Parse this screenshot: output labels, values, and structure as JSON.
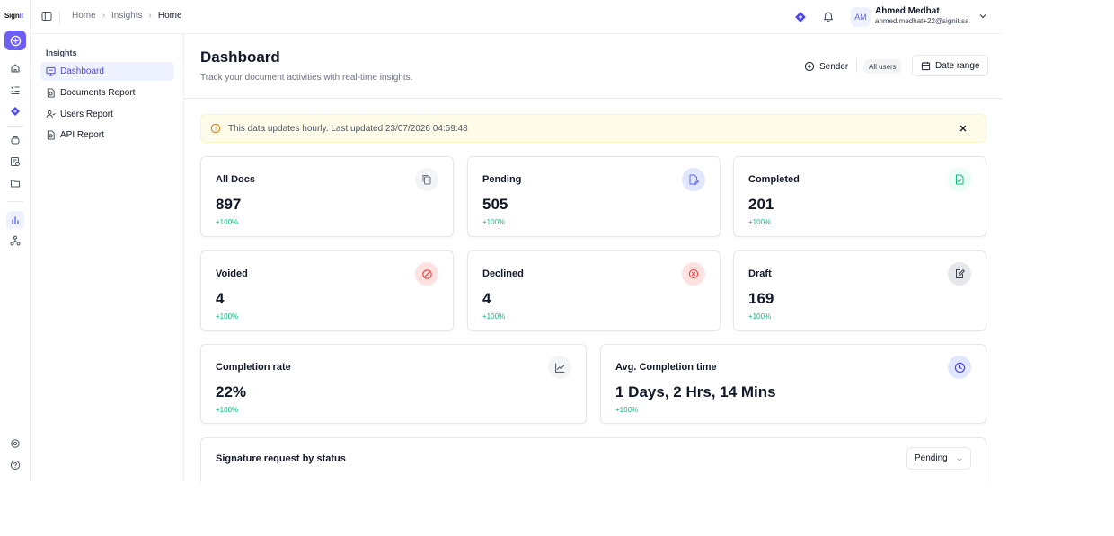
{
  "brand": {
    "logo_text": "Sign",
    "logo_accent": "it",
    "accent_color": "#6d5ff5"
  },
  "rail": {
    "icons": [
      "home-icon",
      "checklist-icon",
      "diamond-icon",
      "stamp-icon",
      "template-icon",
      "folder-icon",
      "chart-icon",
      "org-icon",
      "settings-icon",
      "help-icon"
    ]
  },
  "sidebar": {
    "section": "Insights",
    "items": [
      {
        "label": "Dashboard",
        "icon": "monitor-icon",
        "active": true
      },
      {
        "label": "Documents Report",
        "icon": "doc-report-icon"
      },
      {
        "label": "Users Report",
        "icon": "users-icon"
      },
      {
        "label": "API Report",
        "icon": "api-doc-icon"
      }
    ]
  },
  "topbar": {
    "breadcrumb": [
      "Home",
      "Insights",
      "Home"
    ],
    "user": {
      "initials": "AM",
      "name": "Ahmed Medhat",
      "email": "ahmed.medhat+22@signit.sa"
    }
  },
  "header": {
    "title": "Dashboard",
    "subtitle": "Track your document activities with real-time insights.",
    "sender_label": "Sender",
    "users_filter": "All users",
    "date_label": "Date range"
  },
  "alert": {
    "text": "This data updates hourly. Last updated 23/07/2026 04:59:48"
  },
  "stats": [
    {
      "title": "All Docs",
      "value": "897",
      "delta": "+100%",
      "icon": "copy-icon",
      "color": "#6b7280"
    },
    {
      "title": "Pending",
      "value": "505",
      "delta": "+100%",
      "icon": "doc-sign-icon",
      "color": "#6366f1"
    },
    {
      "title": "Completed",
      "value": "201",
      "delta": "+100%",
      "icon": "doc-check-icon",
      "color": "#10b981"
    },
    {
      "title": "Voided",
      "value": "4",
      "delta": "+100%",
      "icon": "void-icon",
      "color": "#ef4444"
    },
    {
      "title": "Declined",
      "value": "4",
      "delta": "+100%",
      "icon": "x-circle-icon",
      "color": "#ef4444"
    },
    {
      "title": "Draft",
      "value": "169",
      "delta": "+100%",
      "icon": "edit-doc-icon",
      "color": "#374151"
    }
  ],
  "metrics": [
    {
      "title": "Completion rate",
      "value": "22%",
      "delta": "+100%",
      "icon": "line-chart-icon"
    },
    {
      "title": "Avg. Completion time",
      "value": "1 Days, 2 Hrs, 14 Mins",
      "delta": "+100%",
      "icon": "clock-icon"
    }
  ],
  "status_section": {
    "title": "Signature request by status",
    "selected": "Pending"
  }
}
